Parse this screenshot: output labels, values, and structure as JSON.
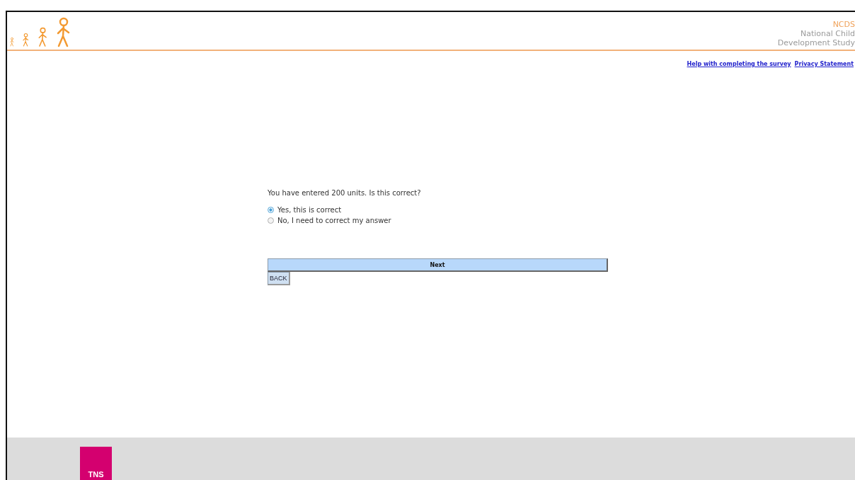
{
  "header": {
    "brand": "NCDS",
    "subtitle_lines": [
      "National Child",
      "Development Study"
    ]
  },
  "links": [
    "Help with completing the survey",
    "Privacy Statement"
  ],
  "question": "You have entered 200 units. Is this correct?",
  "options": [
    {
      "label": "Yes, this is correct",
      "selected": true
    },
    {
      "label": "No, I need to correct my answer",
      "selected": false
    }
  ],
  "buttons": {
    "next": "Next",
    "back": "BACK"
  },
  "footer": {
    "logo": "TNS"
  }
}
